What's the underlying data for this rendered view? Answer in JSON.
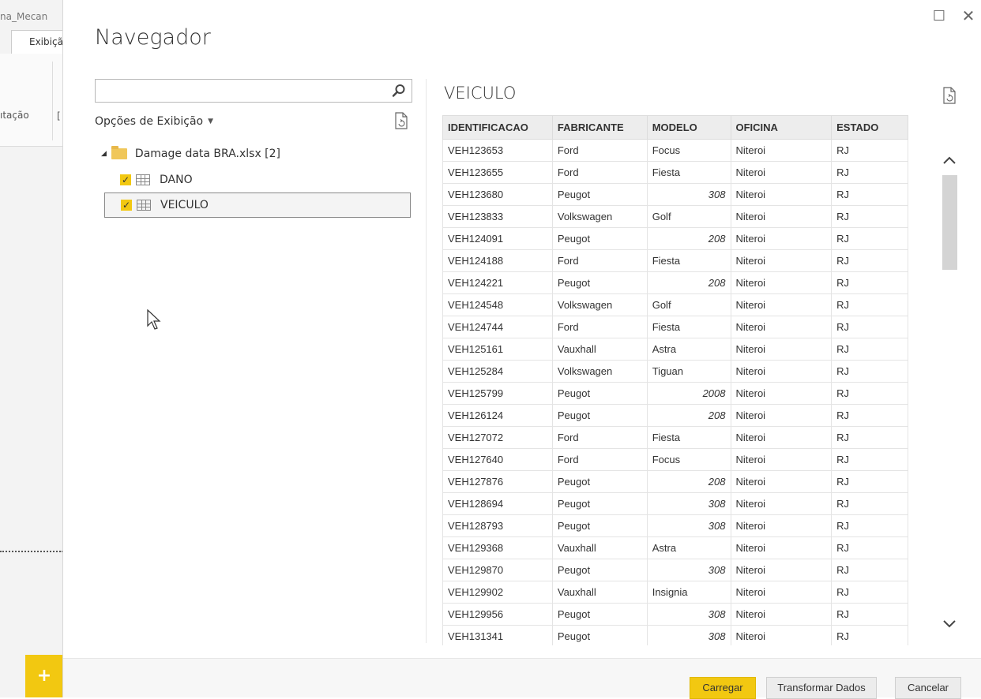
{
  "background": {
    "title": "na_Mecan",
    "tab": "Exibição",
    "ribbon_text": "ıtação",
    "ribbon_letter": "[",
    "add_button": "+"
  },
  "dialog": {
    "title": "Navegador",
    "search_placeholder": "",
    "options_label": "Opções de Exibição",
    "tree": {
      "folder": "Damage data BRA.xlsx [2]",
      "items": [
        {
          "label": "DANO",
          "checked": true
        },
        {
          "label": "VEICULO",
          "checked": true,
          "selected": true
        }
      ]
    }
  },
  "preview": {
    "title": "VEICULO",
    "columns": [
      "IDENTIFICACAO",
      "FABRICANTE",
      "MODELO",
      "OFICINA",
      "ESTADO"
    ],
    "rows": [
      [
        "VEH123653",
        "Ford",
        "Focus",
        "Niteroi",
        "RJ"
      ],
      [
        "VEH123655",
        "Ford",
        "Fiesta",
        "Niteroi",
        "RJ"
      ],
      [
        "VEH123680",
        "Peugot",
        "308",
        "Niteroi",
        "RJ"
      ],
      [
        "VEH123833",
        "Volkswagen",
        "Golf",
        "Niteroi",
        "RJ"
      ],
      [
        "VEH124091",
        "Peugot",
        "208",
        "Niteroi",
        "RJ"
      ],
      [
        "VEH124188",
        "Ford",
        "Fiesta",
        "Niteroi",
        "RJ"
      ],
      [
        "VEH124221",
        "Peugot",
        "208",
        "Niteroi",
        "RJ"
      ],
      [
        "VEH124548",
        "Volkswagen",
        "Golf",
        "Niteroi",
        "RJ"
      ],
      [
        "VEH124744",
        "Ford",
        "Fiesta",
        "Niteroi",
        "RJ"
      ],
      [
        "VEH125161",
        "Vauxhall",
        "Astra",
        "Niteroi",
        "RJ"
      ],
      [
        "VEH125284",
        "Volkswagen",
        "Tiguan",
        "Niteroi",
        "RJ"
      ],
      [
        "VEH125799",
        "Peugot",
        "2008",
        "Niteroi",
        "RJ"
      ],
      [
        "VEH126124",
        "Peugot",
        "208",
        "Niteroi",
        "RJ"
      ],
      [
        "VEH127072",
        "Ford",
        "Fiesta",
        "Niteroi",
        "RJ"
      ],
      [
        "VEH127640",
        "Ford",
        "Focus",
        "Niteroi",
        "RJ"
      ],
      [
        "VEH127876",
        "Peugot",
        "208",
        "Niteroi",
        "RJ"
      ],
      [
        "VEH128694",
        "Peugot",
        "308",
        "Niteroi",
        "RJ"
      ],
      [
        "VEH128793",
        "Peugot",
        "308",
        "Niteroi",
        "RJ"
      ],
      [
        "VEH129368",
        "Vauxhall",
        "Astra",
        "Niteroi",
        "RJ"
      ],
      [
        "VEH129870",
        "Peugot",
        "308",
        "Niteroi",
        "RJ"
      ],
      [
        "VEH129902",
        "Vauxhall",
        "Insignia",
        "Niteroi",
        "RJ"
      ],
      [
        "VEH129956",
        "Peugot",
        "308",
        "Niteroi",
        "RJ"
      ],
      [
        "VEH131341",
        "Peugot",
        "308",
        "Niteroi",
        "RJ"
      ]
    ]
  },
  "buttons": {
    "load": "Carregar",
    "transform": "Transformar Dados",
    "cancel": "Cancelar"
  },
  "colors": {
    "accent": "#f2c811",
    "header_bg": "#ededed"
  }
}
